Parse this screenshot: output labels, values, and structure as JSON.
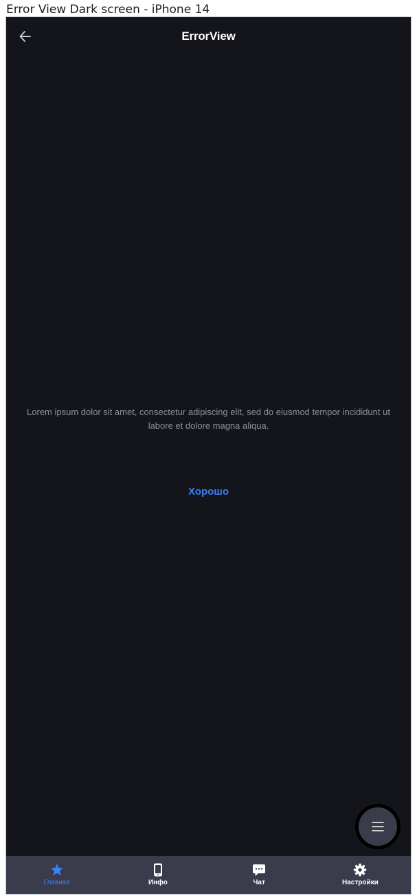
{
  "frame": {
    "title": "Error View Dark screen - iPhone 14"
  },
  "nav": {
    "title": "ErrorView",
    "back_icon": "arrow-left-icon"
  },
  "error": {
    "message": "Lorem ipsum dolor sit amet, consectetur adipiscing elit, sed do eiusmod tempor incididunt ut labore et dolore magna aliqua.",
    "button_label": "Хорошо"
  },
  "fab": {
    "icon": "menu-icon"
  },
  "tabbar": {
    "items": [
      {
        "label": "Главная",
        "icon": "star-icon",
        "active": true
      },
      {
        "label": "Инфо",
        "icon": "phone-icon",
        "active": false
      },
      {
        "label": "Чат",
        "icon": "chat-icon",
        "active": false
      },
      {
        "label": "Настройки",
        "icon": "gear-icon",
        "active": false
      }
    ]
  },
  "colors": {
    "background": "#14151b",
    "surface": "#3a3c4b",
    "accent": "#3d7ff5",
    "muted_text": "#8e8f99"
  }
}
